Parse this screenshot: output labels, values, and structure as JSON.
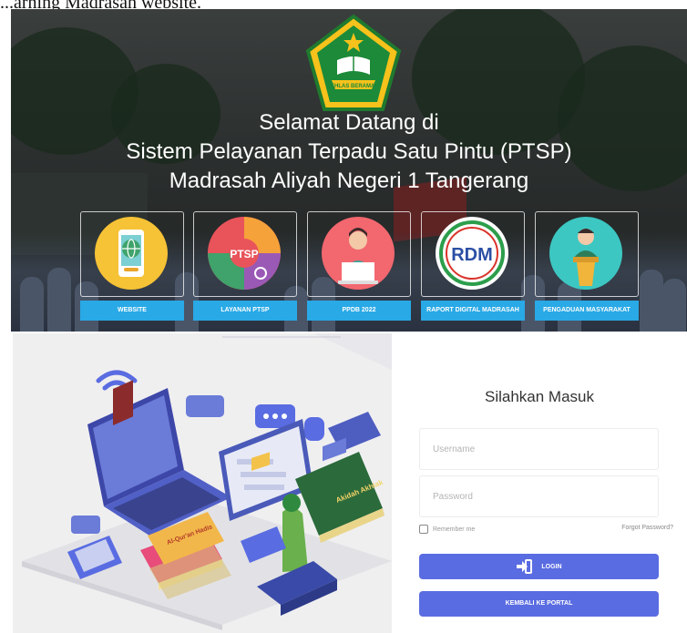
{
  "caption": "...arning Madrasah website.",
  "hero": {
    "title_line1": "Selamat Datang di",
    "title_line2": "Sistem Pelayanan Terpadu Satu Pintu (PTSP)",
    "title_line3": "Madrasah Aliyah Negeri 1 Tangerang",
    "emblem_text": "IKHLAS BERAMAL",
    "tiles": [
      {
        "label": "WEBSITE",
        "icon": "globe-phone-icon",
        "color": "#f6c236"
      },
      {
        "label": "LAYANAN PTSP",
        "icon": "ptsp-services-icon",
        "color": "#e8545a",
        "icon_text": "PTSP"
      },
      {
        "label": "PPDB 2022",
        "icon": "person-laptop-icon",
        "color": "#f3676f"
      },
      {
        "label": "RAPORT DIGITAL MADRASAH",
        "icon": "rdm-logo-icon",
        "color": "#ffffff",
        "icon_text": "RDM"
      },
      {
        "label": "PENGADUAN MASYARAKAT",
        "icon": "speaker-podium-icon",
        "color": "#3cc7c2"
      }
    ],
    "button_color": "#29a9e6"
  },
  "login": {
    "title": "Silahkan Masuk",
    "username_placeholder": "Username",
    "password_placeholder": "Password",
    "remember_label": "Remember me",
    "forgot_label": "Forgot Password?",
    "login_label": "LOGIN",
    "portal_label": "KEMBALI KE PORTAL",
    "accent": "#5a6ce1"
  },
  "illustration": {
    "book_title": "Akidah Akhlak",
    "book2_title": "Al-Qur'an Hadis"
  }
}
